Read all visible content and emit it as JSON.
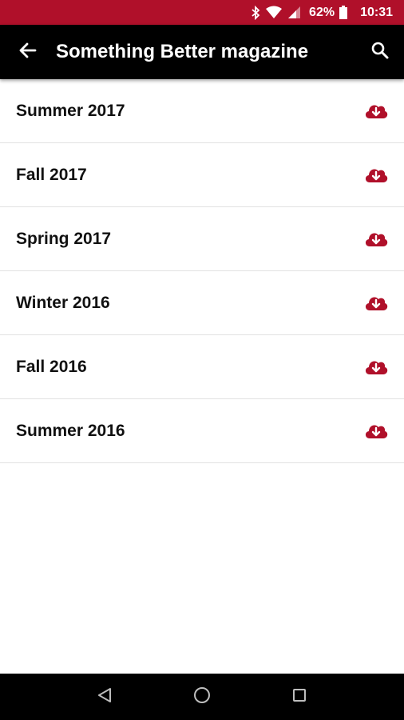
{
  "status_bar": {
    "battery_percent": "62%",
    "time": "10:31",
    "icons": [
      "bluetooth-icon",
      "wifi-icon",
      "signal-icon",
      "battery-icon"
    ]
  },
  "app_bar": {
    "title": "Something Better magazine",
    "back_icon": "arrow-back-icon",
    "search_icon": "search-icon"
  },
  "colors": {
    "accent": "#b0102a",
    "app_bar_bg": "#000000",
    "text": "#111111",
    "divider": "#e2e2e2"
  },
  "issues": [
    {
      "label": "Summer 2017",
      "action_icon": "cloud-download-icon"
    },
    {
      "label": "Fall 2017",
      "action_icon": "cloud-download-icon"
    },
    {
      "label": "Spring 2017",
      "action_icon": "cloud-download-icon"
    },
    {
      "label": "Winter 2016",
      "action_icon": "cloud-download-icon"
    },
    {
      "label": "Fall 2016",
      "action_icon": "cloud-download-icon"
    },
    {
      "label": "Summer 2016",
      "action_icon": "cloud-download-icon"
    }
  ],
  "nav_bar": {
    "buttons": [
      "back-triangle-icon",
      "home-circle-icon",
      "recents-square-icon"
    ]
  }
}
